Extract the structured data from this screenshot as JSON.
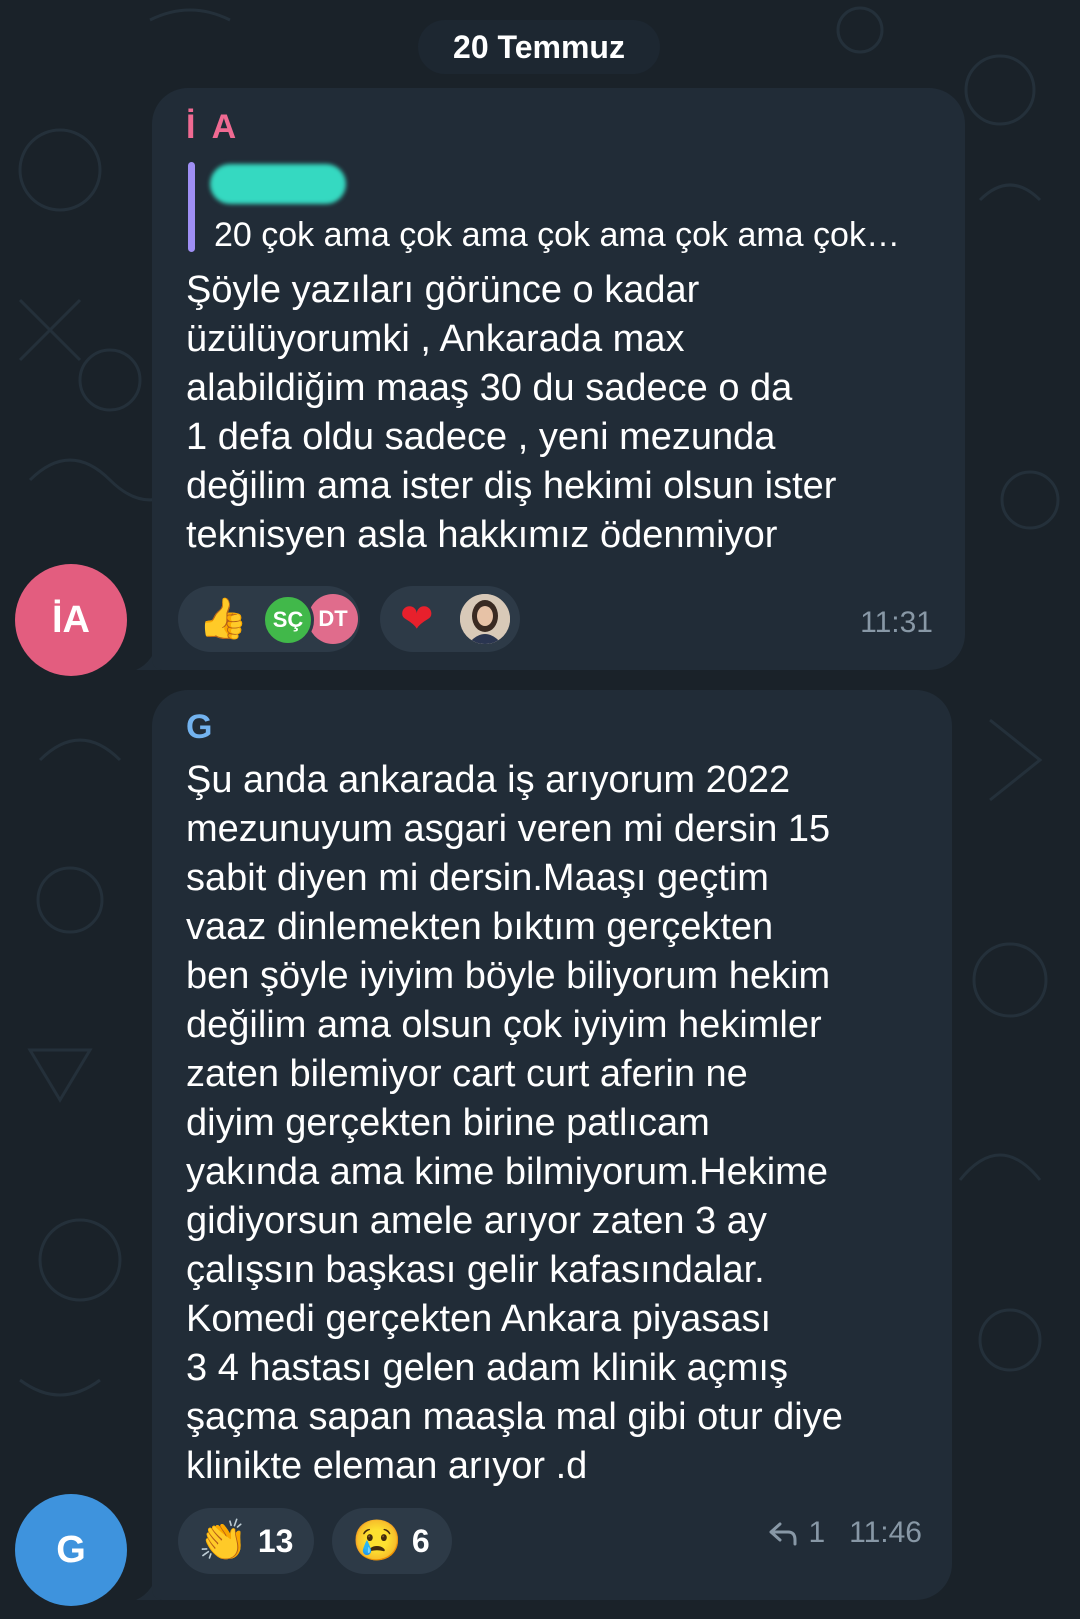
{
  "date_separator": "20 Temmuz",
  "messages": [
    {
      "avatar_initials": "İA",
      "sender": "İ A",
      "reply_quote": "20 çok ama çok ama çok ama çok ama çok…",
      "text": "Şöyle yazıları görünce o kadar\nüzülüyorumki , Ankarada max\nalabildiğim maaş 30 du sadece o da\n1 defa oldu sadece , yeni mezunda\ndeğilim ama ister diş hekimi olsun ister\nteknisyen asla hakkımız ödenmiyor",
      "reactions": [
        {
          "icon": "thumbs-up-icon",
          "emoji": "👍",
          "reactor_initials": [
            "SÇ",
            "DT"
          ]
        },
        {
          "icon": "heart-icon",
          "emoji": "❤️"
        }
      ],
      "time": "11:31"
    },
    {
      "avatar_initials": "G",
      "sender": "G",
      "text": "Şu anda ankarada iş arıyorum 2022\nmezunuyum asgari veren mi dersin 15\nsabit diyen mi dersin.Maaşı geçtim\nvaaz dinlemekten bıktım gerçekten\nben şöyle iyiyim böyle biliyorum hekim\ndeğilim ama olsun çok iyiyim hekimler\nzaten bilemiyor cart curt aferin ne\ndiyim gerçekten birine patlıcam\nyakında ama kime bilmiyorum.Hekime\ngidiyorsun amele arıyor zaten 3 ay\nçalışsın başkası gelir kafasındalar.\nKomedi gerçekten Ankara piyasası\n3 4 hastası gelen adam klinik açmış\nşaçma sapan maaşla mal gibi otur diye\nklinikte  eleman arıyor  .d",
      "reactions": [
        {
          "icon": "clapping-hands-icon",
          "emoji": "👏",
          "count": "13"
        },
        {
          "icon": "crying-face-icon",
          "emoji": "😢",
          "count": "6"
        }
      ],
      "reply_count": "1",
      "time": "11:46"
    }
  ],
  "colors": {
    "background": "#1a2229",
    "bubble": "#212c37",
    "sender_ia": "#f06a92",
    "sender_g": "#73b3ef",
    "avatar_ia": "#e35d7f",
    "avatar_g": "#3e93dd",
    "quote_bar": "#9f8ff4",
    "redaction": "#35d9c1",
    "meta_text": "#8898a6"
  }
}
